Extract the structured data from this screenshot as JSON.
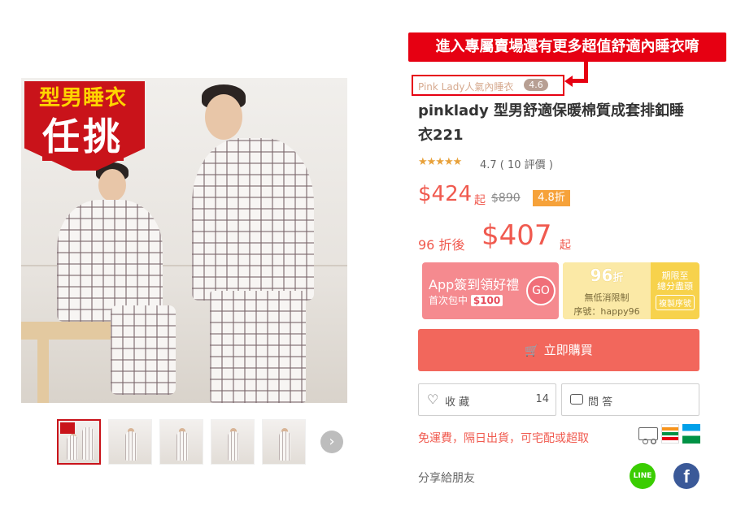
{
  "annotation": {
    "text": "進入專屬賣場還有更多超值舒適內睡衣唷"
  },
  "gallery": {
    "promo_line1": "型男睡衣",
    "promo_line2": "任挑",
    "thumb_count": 5,
    "next_icon": "chevron-right-icon"
  },
  "store": {
    "name": "Pink Lady人氣內睡衣",
    "rating": "4.6"
  },
  "product": {
    "title": "pinklady 型男舒適保暖棉質成套排釦睡衣221",
    "stars": "★★★★★",
    "rating_text": "4.7 ( 10 評價 )",
    "price": "$424",
    "price_suffix": "起",
    "original_price": "$890",
    "discount": "4.8折",
    "after_label": "96 折後",
    "after_price": "$407",
    "after_suffix": "起"
  },
  "app_banner": {
    "title": "App簽到領好禮",
    "subtitle": "首次包中",
    "amount": "$100",
    "go": "GO"
  },
  "coupon": {
    "percent": "96",
    "percent_suffix": "折",
    "condition": "無低消限制",
    "code": "序號：happy96",
    "limit": "期限至\n總分盡頭",
    "copy": "複製序號"
  },
  "actions": {
    "buy_label": "立即購買",
    "buy_icon": "cart-icon",
    "favorite_label": "收 藏",
    "favorite_count": "14",
    "qa_label": "問 答"
  },
  "shipping": {
    "text": "免運費，隔日出貨，可宅配或超取"
  },
  "share": {
    "label": "分享給朋友",
    "line_text": "LINE",
    "fb_text": "f"
  },
  "colors": {
    "accent_red": "#e60012",
    "price": "#f05a4f",
    "buy": "#f2675c",
    "coupon": "#f7d24c"
  }
}
